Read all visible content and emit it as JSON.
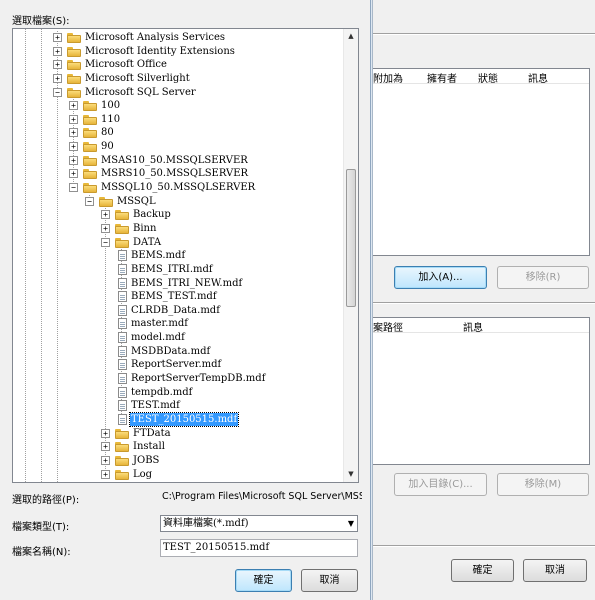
{
  "file_dialog": {
    "select_label": "選取檔案(S):",
    "path_label": "選取的路徑(P):",
    "path_value": "C:\\Program Files\\Microsoft SQL Server\\MSSQL1",
    "type_label": "檔案類型(T):",
    "type_value": "資料庫檔案(*.mdf)",
    "name_label": "檔案名稱(N):",
    "name_value": "TEST_20150515.mdf",
    "ok_button": "確定",
    "cancel_button": "取消",
    "tree": [
      {
        "label": "Microsoft Analysis Services",
        "level": 3,
        "kind": "folder",
        "exp": "+"
      },
      {
        "label": "Microsoft Identity Extensions",
        "level": 3,
        "kind": "folder",
        "exp": "+"
      },
      {
        "label": "Microsoft Office",
        "level": 3,
        "kind": "folder",
        "exp": "+"
      },
      {
        "label": "Microsoft Silverlight",
        "level": 3,
        "kind": "folder",
        "exp": "+"
      },
      {
        "label": "Microsoft SQL Server",
        "level": 3,
        "kind": "folder",
        "exp": "-"
      },
      {
        "label": "100",
        "level": 4,
        "kind": "folder",
        "exp": "+"
      },
      {
        "label": "110",
        "level": 4,
        "kind": "folder",
        "exp": "+"
      },
      {
        "label": "80",
        "level": 4,
        "kind": "folder",
        "exp": "+"
      },
      {
        "label": "90",
        "level": 4,
        "kind": "folder",
        "exp": "+"
      },
      {
        "label": "MSAS10_50.MSSQLSERVER",
        "level": 4,
        "kind": "folder",
        "exp": "+"
      },
      {
        "label": "MSRS10_50.MSSQLSERVER",
        "level": 4,
        "kind": "folder",
        "exp": "+"
      },
      {
        "label": "MSSQL10_50.MSSQLSERVER",
        "level": 4,
        "kind": "folder",
        "exp": "-"
      },
      {
        "label": "MSSQL",
        "level": 5,
        "kind": "folder",
        "exp": "-"
      },
      {
        "label": "Backup",
        "level": 6,
        "kind": "folder",
        "exp": "+"
      },
      {
        "label": "Binn",
        "level": 6,
        "kind": "folder",
        "exp": "+"
      },
      {
        "label": "DATA",
        "level": 6,
        "kind": "folder",
        "exp": "-"
      },
      {
        "label": "BEMS.mdf",
        "level": 7,
        "kind": "file"
      },
      {
        "label": "BEMS_ITRI.mdf",
        "level": 7,
        "kind": "file"
      },
      {
        "label": "BEMS_ITRI_NEW.mdf",
        "level": 7,
        "kind": "file"
      },
      {
        "label": "BEMS_TEST.mdf",
        "level": 7,
        "kind": "file"
      },
      {
        "label": "CLRDB_Data.mdf",
        "level": 7,
        "kind": "file"
      },
      {
        "label": "master.mdf",
        "level": 7,
        "kind": "file"
      },
      {
        "label": "model.mdf",
        "level": 7,
        "kind": "file"
      },
      {
        "label": "MSDBData.mdf",
        "level": 7,
        "kind": "file"
      },
      {
        "label": "ReportServer.mdf",
        "level": 7,
        "kind": "file"
      },
      {
        "label": "ReportServerTempDB.mdf",
        "level": 7,
        "kind": "file"
      },
      {
        "label": "tempdb.mdf",
        "level": 7,
        "kind": "file"
      },
      {
        "label": "TEST.mdf",
        "level": 7,
        "kind": "file"
      },
      {
        "label": "TEST_20150515.mdf",
        "level": 7,
        "kind": "file",
        "selected": true
      },
      {
        "label": "FTData",
        "level": 6,
        "kind": "folder",
        "exp": "+"
      },
      {
        "label": "Install",
        "level": 6,
        "kind": "folder",
        "exp": "+"
      },
      {
        "label": "JOBS",
        "level": 6,
        "kind": "folder",
        "exp": "+"
      },
      {
        "label": "Log",
        "level": 6,
        "kind": "folder",
        "exp": "+"
      }
    ]
  },
  "background_dialog": {
    "list1_headers": [
      "附加為",
      "擁有者",
      "狀態",
      "訊息"
    ],
    "add_button": "加入(A)...",
    "remove_button": "移除(R)",
    "list2_headers": [
      "案路徑",
      "訊息"
    ],
    "add_catalog_button": "加入目錄(C)...",
    "remove2_button": "移除(M)",
    "ok_button": "確定",
    "cancel_button": "取消"
  }
}
